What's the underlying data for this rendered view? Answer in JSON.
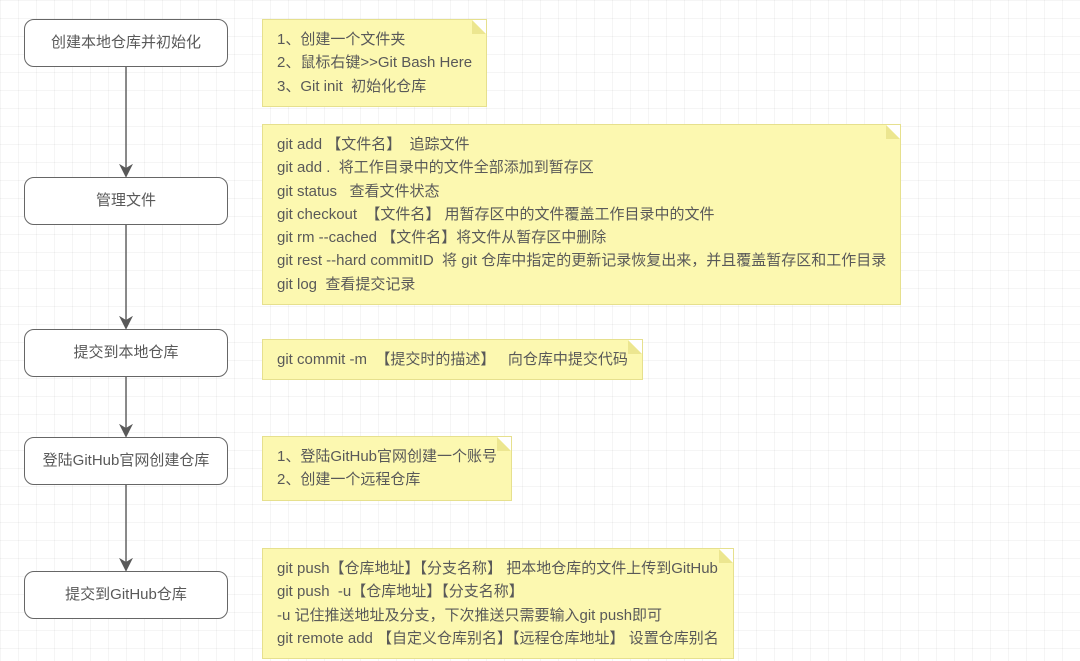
{
  "nodes": [
    {
      "id": "n1",
      "label": "创建本地仓库并初始化"
    },
    {
      "id": "n2",
      "label": "管理文件"
    },
    {
      "id": "n3",
      "label": "提交到本地仓库"
    },
    {
      "id": "n4",
      "label": "登陆GitHub官网创建仓库"
    },
    {
      "id": "n5",
      "label": "提交到GitHub仓库"
    }
  ],
  "notes": {
    "note1": "1、创建一个文件夹\n2、鼠标右键>>Git Bash Here\n3、Git init  初始化仓库",
    "note2": "git add 【文件名】  追踪文件\ngit add .  将工作目录中的文件全部添加到暂存区\ngit status   查看文件状态\ngit checkout  【文件名】 用暂存区中的文件覆盖工作目录中的文件\ngit rm --cached 【文件名】将文件从暂存区中删除\ngit rest --hard commitID  将 git 仓库中指定的更新记录恢复出来，并且覆盖暂存区和工作目录\ngit log  查看提交记录",
    "note3": "git commit -m  【提交时的描述】   向仓库中提交代码",
    "note4": "1、登陆GitHub官网创建一个账号\n2、创建一个远程仓库",
    "note5": "git push【仓库地址】【分支名称】 把本地仓库的文件上传到GitHub\ngit push  -u【仓库地址】【分支名称】\n-u 记住推送地址及分支，下次推送只需要输入git push即可\ngit remote add 【自定义仓库别名】【远程仓库地址】 设置仓库别名"
  }
}
